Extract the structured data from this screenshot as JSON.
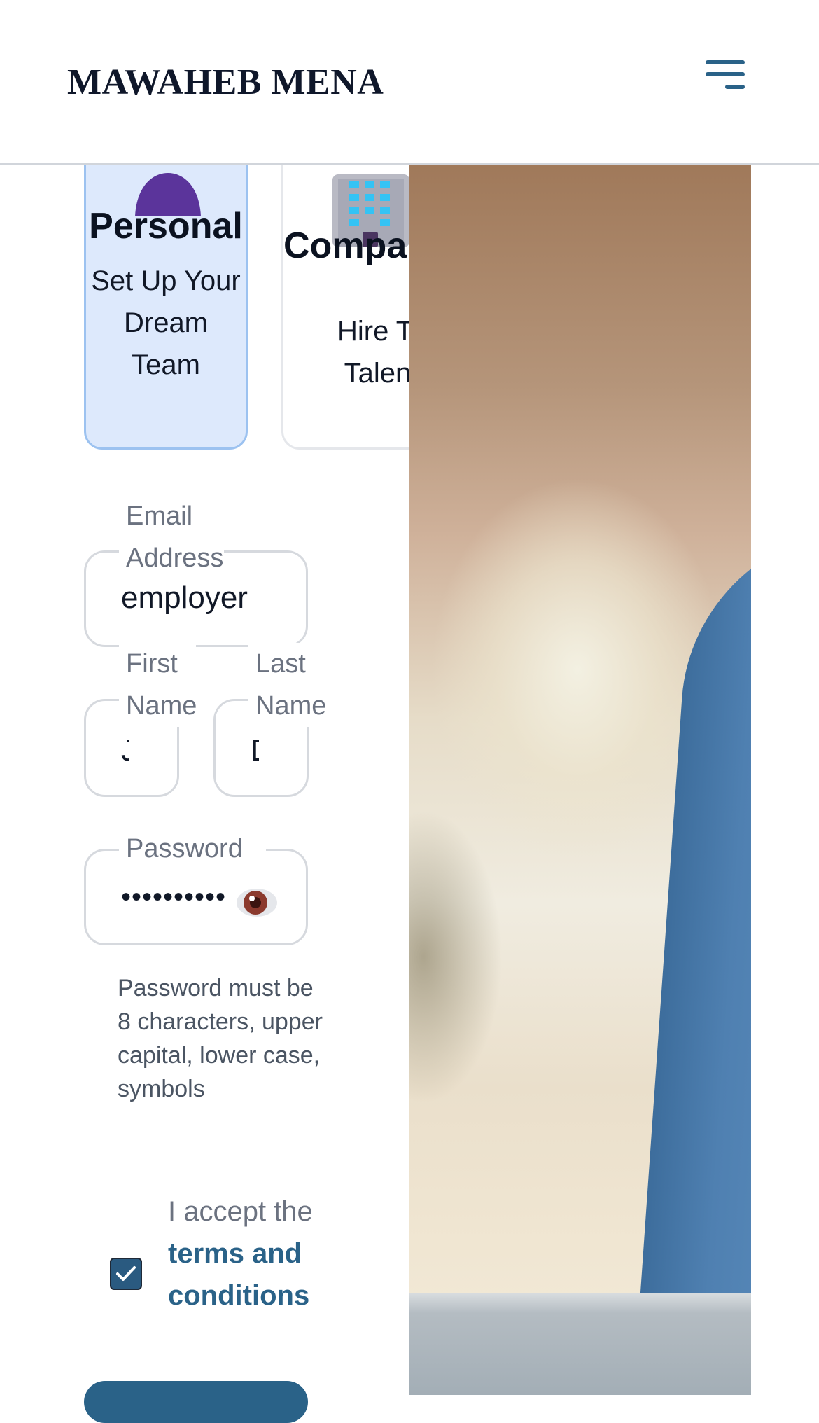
{
  "header": {
    "brand": "MAWAHEB MENA",
    "menu_icon": "hamburger-menu-icon"
  },
  "account_types": [
    {
      "title": "Personal",
      "subtitle": "Set Up Your Dream Team",
      "icon": "person-icon",
      "selected": true
    },
    {
      "title": "Compa",
      "subtitle": "Hire To Talent",
      "icon": "office-building-icon",
      "selected": false
    }
  ],
  "form": {
    "email": {
      "label": "Email Address",
      "value": "employer"
    },
    "first_name": {
      "label": "First Name",
      "value": "J"
    },
    "last_name": {
      "label": "Last Name",
      "value": "D"
    },
    "password": {
      "label": "Password",
      "value": "••••••••••",
      "toggle_icon": "eye-icon"
    },
    "password_hint": "Password must be 8 characters, upper capital, lower case, symbols",
    "terms": {
      "checked": true,
      "prefix": "I accept the",
      "link": "terms and conditions"
    }
  },
  "colors": {
    "accent": "#2a6288",
    "selected_card_bg": "#dde9fc",
    "selected_card_border": "#9cc2f0"
  }
}
